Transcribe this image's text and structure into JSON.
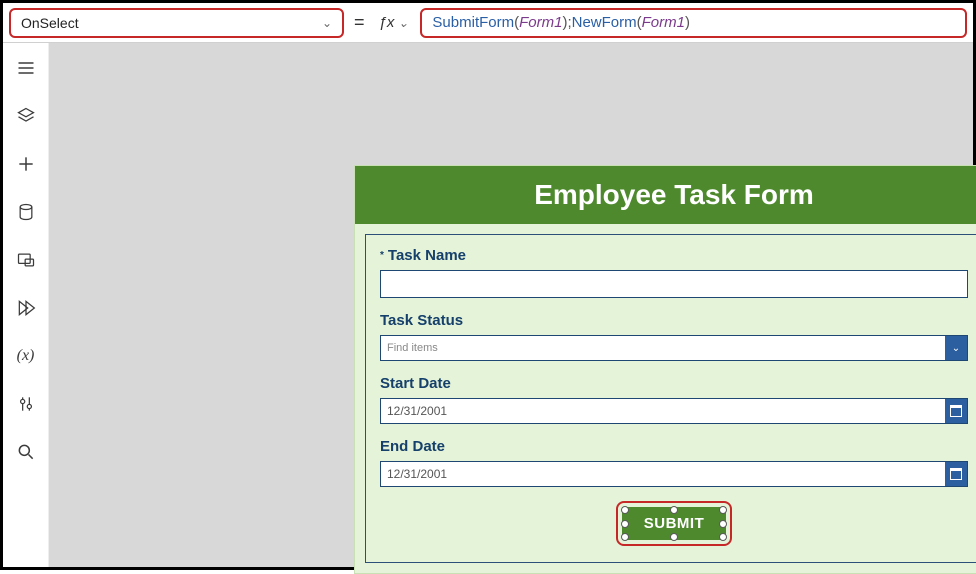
{
  "propertyDropdown": {
    "value": "OnSelect"
  },
  "formula": {
    "fn1": "SubmitForm",
    "arg1": "Form1",
    "fn2": "NewForm",
    "arg2": "Form1"
  },
  "rail": {
    "tree": "tree-view-icon",
    "layers": "layers-icon",
    "insert": "insert-icon",
    "data": "data-icon",
    "media": "media-icon",
    "power": "power-automate-icon",
    "vars": "variables-icon",
    "tools": "tools-icon",
    "search": "search-icon"
  },
  "form": {
    "title": "Employee Task Form",
    "fields": {
      "taskName": {
        "label": "Task Name"
      },
      "taskStatus": {
        "label": "Task Status",
        "placeholder": "Find items"
      },
      "startDate": {
        "label": "Start Date",
        "value": "12/31/2001"
      },
      "endDate": {
        "label": "End Date",
        "value": "12/31/2001"
      }
    },
    "submit": "SUBMIT"
  }
}
